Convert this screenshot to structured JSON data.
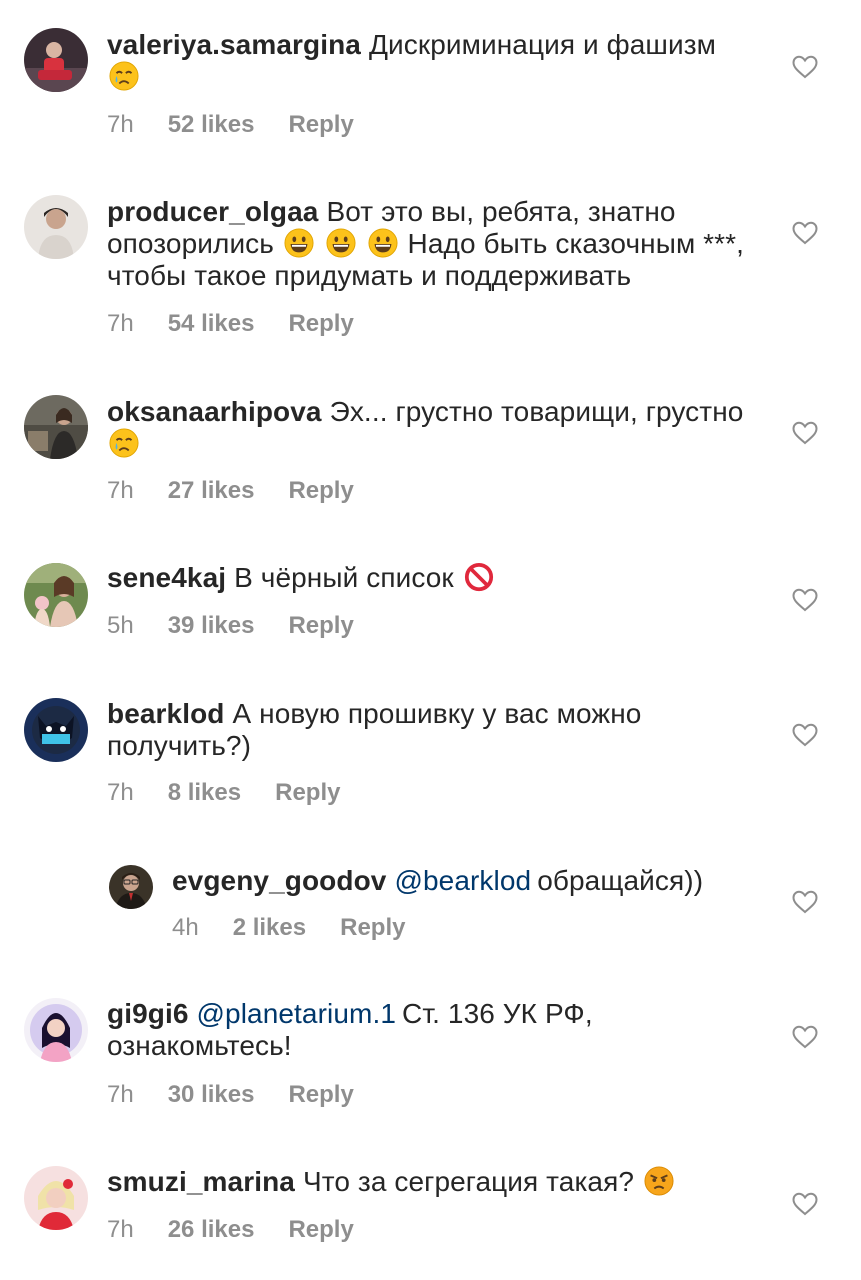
{
  "comments": [
    {
      "username": "valeriya.samargina",
      "text": "Дискриминация и фашизм",
      "time": "7h",
      "likes": "52 likes",
      "reply": "Reply"
    },
    {
      "username": "producer_olgaa",
      "text": "Вот это вы, ребята, знатно опозорились",
      "text2": "Надо быть сказочным ***, чтобы такое придумать и поддерживать",
      "time": "7h",
      "likes": "54 likes",
      "reply": "Reply"
    },
    {
      "username": "oksanaarhipova",
      "text": "Эх... грустно товарищи, грустно",
      "time": "7h",
      "likes": "27 likes",
      "reply": "Reply"
    },
    {
      "username": "sene4kaj",
      "text": "В чёрный список",
      "time": "5h",
      "likes": "39 likes",
      "reply": "Reply"
    },
    {
      "username": "bearklod",
      "text": "А новую прошивку у вас можно получить?)",
      "time": "7h",
      "likes": "8 likes",
      "reply": "Reply"
    },
    {
      "username": "evgeny_goodov",
      "mention": "@bearklod",
      "text": "обращайся))",
      "time": "4h",
      "likes": "2 likes",
      "reply": "Reply"
    },
    {
      "username": "gi9gi6",
      "mention": "@planetarium.1",
      "text": "Ст. 136 УК РФ, ознакомьтесь!",
      "time": "7h",
      "likes": "30 likes",
      "reply": "Reply"
    },
    {
      "username": "smuzi_marina",
      "text": "Что за сегрегация такая?",
      "time": "7h",
      "likes": "26 likes",
      "reply": "Reply"
    }
  ],
  "icons": {
    "heart": "heart-outline-icon",
    "emoji_cry": "crying-face-emoji",
    "emoji_grin": "grinning-face-emoji",
    "emoji_prohibited": "prohibited-emoji",
    "emoji_angry": "angry-face-emoji"
  },
  "colors": {
    "text": "#262626",
    "secondary": "#8e8e8e",
    "mention": "#00376b"
  }
}
